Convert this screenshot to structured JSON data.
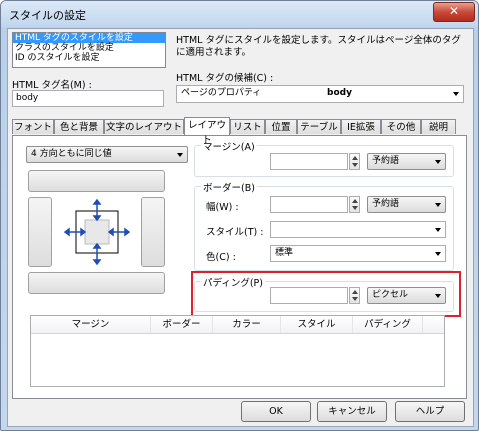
{
  "window": {
    "title": "スタイルの設定",
    "close_icon": "close-icon"
  },
  "style_types": [
    "HTML タグのスタイルを設定",
    "クラスのスタイルを設定",
    "ID のスタイルを設定"
  ],
  "description": "HTML タグにスタイルを設定します。スタイルはページ全体のタグに適用されます。",
  "tag_name_label": "HTML タグ名(M) :",
  "tag_name_value": "body",
  "tag_candidate_label": "HTML タグの候補(C) :",
  "tag_candidate_prefix": "ページのプロパティ",
  "tag_candidate_value": "body",
  "tabs": [
    "フォント",
    "色と背景",
    "文字のレイアウト",
    "レイアウト",
    "リスト",
    "位置",
    "テーブル",
    "IE拡張",
    "その他",
    "説明"
  ],
  "active_tab": "レイアウト",
  "direction_select": "4 方向ともに同じ値",
  "margin": {
    "label": "マージン(A)",
    "value": "",
    "unit": "予約語"
  },
  "border": {
    "label": "ボーダー(B)",
    "width_label": "幅(W) :",
    "width_value": "",
    "width_unit": "予約語",
    "style_label": "スタイル(T) :",
    "style_value": "",
    "color_label": "色(C) :",
    "color_value": "標準"
  },
  "padding": {
    "label": "パディング(P)",
    "value": "",
    "unit": "ピクセル"
  },
  "listview_columns": [
    "マージン",
    "ボーダー",
    "カラー",
    "スタイル",
    "パディング"
  ],
  "buttons": {
    "ok": "OK",
    "cancel": "キャンセル",
    "help": "ヘルプ"
  },
  "colors": {
    "highlight": "#e0202a",
    "selection": "#3399ff",
    "arrow_blue": "#1f4fb5"
  }
}
